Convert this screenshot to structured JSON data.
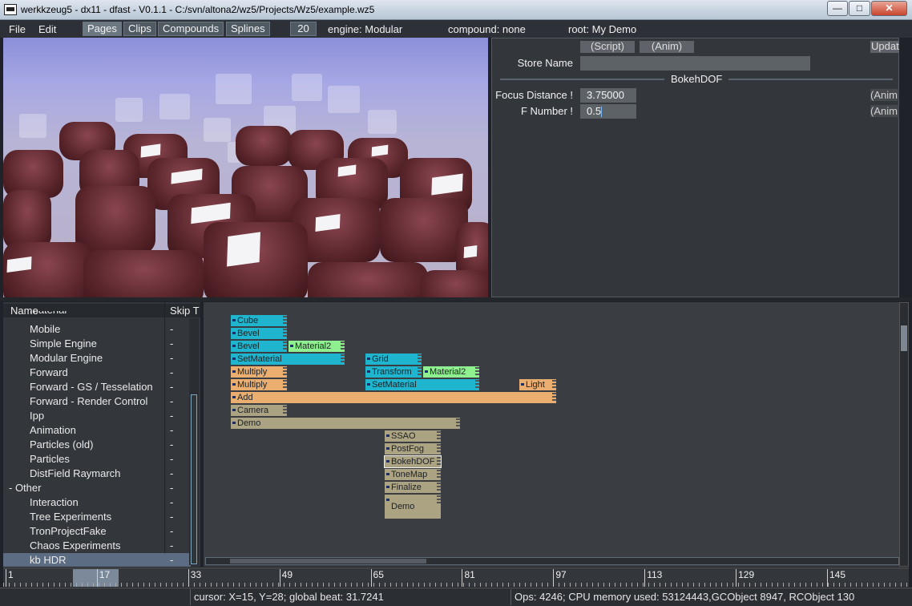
{
  "window": {
    "title": "werkkzeug5 - dx11 - dfast - V0.1.1 - C:/svn/altona2/wz5/Projects/Wz5/example.wz5",
    "min_glyph": "—",
    "max_glyph": "□",
    "close_glyph": "✕"
  },
  "menubar": {
    "file": "File",
    "edit": "Edit",
    "tabs": [
      "Pages",
      "Clips",
      "Compounds",
      "Splines"
    ],
    "active_tab": "Pages",
    "number": "20",
    "engine": "engine: Modular",
    "compound": "compound: none",
    "root": "root: My Demo"
  },
  "properties": {
    "script_btn": "(Script)",
    "anim_btn": "(Anim)",
    "update_btn": "Updat",
    "store_name_label": "Store Name",
    "store_name_value": "",
    "section_title": "BokehDOF",
    "focus_label": "Focus Distance !",
    "focus_value": "3.75000",
    "fnumber_label": "F Number !",
    "fnumber_value": "0.5",
    "anim_side": "(Anim"
  },
  "tree": {
    "col_name": "Name",
    "col_skip": "Skip T",
    "rows": [
      {
        "name": "Material",
        "skip": "",
        "indent": 1
      },
      {
        "name": "Mobile",
        "skip": "-",
        "indent": 1
      },
      {
        "name": "Simple Engine",
        "skip": "-",
        "indent": 1
      },
      {
        "name": "Modular Engine",
        "skip": "-",
        "indent": 1
      },
      {
        "name": "Forward",
        "skip": "-",
        "indent": 1
      },
      {
        "name": "Forward - GS / Tesselation",
        "skip": "-",
        "indent": 1
      },
      {
        "name": "Forward - Render Control",
        "skip": "-",
        "indent": 1
      },
      {
        "name": "Ipp",
        "skip": "-",
        "indent": 1
      },
      {
        "name": "Animation",
        "skip": "-",
        "indent": 1
      },
      {
        "name": "Particles (old)",
        "skip": "-",
        "indent": 1
      },
      {
        "name": "Particles",
        "skip": "-",
        "indent": 1
      },
      {
        "name": "DistField Raymarch",
        "skip": "-",
        "indent": 1
      },
      {
        "name": "- Other",
        "skip": "-",
        "indent": 0
      },
      {
        "name": "Interaction",
        "skip": "-",
        "indent": 1
      },
      {
        "name": "Tree Experiments",
        "skip": "-",
        "indent": 1
      },
      {
        "name": "TronProjectFake",
        "skip": "-",
        "indent": 1
      },
      {
        "name": "Chaos Experiments",
        "skip": "-",
        "indent": 1
      },
      {
        "name": "kb HDR",
        "skip": "-",
        "indent": 1,
        "selected": true
      }
    ]
  },
  "ops": [
    {
      "label": "Cube",
      "color": "cyan"
    },
    {
      "label": "Bevel",
      "color": "cyan"
    },
    {
      "label": "Bevel",
      "color": "cyan"
    },
    {
      "label": "Material2",
      "color": "green"
    },
    {
      "label": "SetMaterial",
      "color": "cyan"
    },
    {
      "label": "Grid",
      "color": "cyan"
    },
    {
      "label": "Multiply",
      "color": "orange"
    },
    {
      "label": "Transform",
      "color": "cyan"
    },
    {
      "label": "Material2",
      "color": "green"
    },
    {
      "label": "Multiply",
      "color": "orange"
    },
    {
      "label": "SetMaterial",
      "color": "cyan"
    },
    {
      "label": "Light",
      "color": "orange"
    },
    {
      "label": "Add",
      "color": "orange"
    },
    {
      "label": "Camera",
      "color": "tan"
    },
    {
      "label": "Demo",
      "color": "tan"
    },
    {
      "label": "SSAO",
      "color": "tan"
    },
    {
      "label": "PostFog",
      "color": "tan"
    },
    {
      "label": "BokehDOF",
      "color": "tan",
      "selected": true
    },
    {
      "label": "ToneMap",
      "color": "tan"
    },
    {
      "label": "Finalize",
      "color": "tan"
    },
    {
      "label": "Demo",
      "color": "tan"
    }
  ],
  "timeline": {
    "labels": [
      "1",
      "17",
      "33",
      "49",
      "65",
      "81",
      "97",
      "113",
      "129",
      "145"
    ],
    "selected_range": [
      17,
      25
    ]
  },
  "status": {
    "cursor": "cursor: X=15, Y=28; global beat: 31.7241",
    "memory": "Ops: 4246; CPU memory used: 53124443,GCObject 8947, RCObject 130"
  },
  "colors": {
    "op_cyan": "#1fb5cf",
    "op_green": "#8ff08f",
    "op_orange": "#e9ae70",
    "op_tan": "#aca383",
    "selection": "#5c6c82"
  },
  "icons": [
    "app-icon",
    "minimize-icon",
    "maximize-icon",
    "close-icon"
  ]
}
